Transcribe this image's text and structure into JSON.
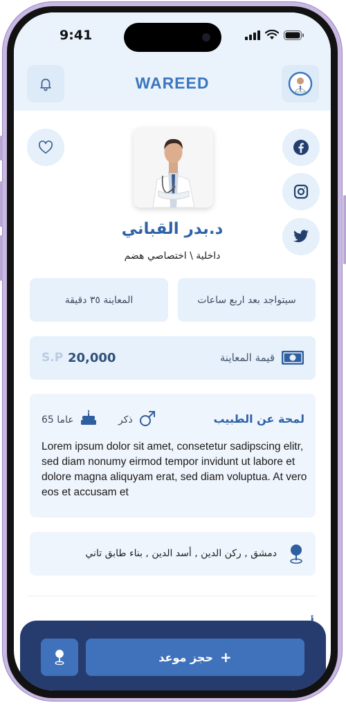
{
  "status_bar": {
    "time": "9:41"
  },
  "header": {
    "logo": "WAREED"
  },
  "doctor": {
    "name": "د.بدر القباني",
    "specialty": "داخلية \\ اختصاصي هضم"
  },
  "info_cards": {
    "availability": "سيتواجد بعد اربع ساعات",
    "duration": "المعاينة ٣٥ دقيقة"
  },
  "price": {
    "label": "قيمة المعاينة",
    "value": "20,000",
    "currency": "S.P"
  },
  "about": {
    "title": "لمحة عن الطبيب",
    "gender": "ذكر",
    "age": "عاما 65",
    "description": "Lorem ipsum dolor sit amet, consetetur sadipscing elitr, sed diam nonumy eirmod tempor invidunt ut labore et dolore magna aliquyam erat, sed diam voluptua. At vero eos et accusam et"
  },
  "address": {
    "text": "دمشق , ركن الدين , أسد الدين , بناء طابق تاني"
  },
  "next_section": {
    "title_partial": "أ"
  },
  "bottom_bar": {
    "book_label": "حجز موعد",
    "plus": "+"
  },
  "icons": {
    "notifications": "bell-icon",
    "favorite": "heart-icon",
    "facebook": "facebook-icon",
    "instagram": "instagram-icon",
    "twitter": "twitter-icon",
    "gender": "male-icon",
    "age": "cake-icon",
    "price": "banknote-icon",
    "location": "map-pin-icon"
  },
  "colors": {
    "primary": "#3b76bf",
    "dark_bar": "#263c6e",
    "card_bg": "#e7f1fb",
    "header_bg": "#eaf3fc"
  }
}
